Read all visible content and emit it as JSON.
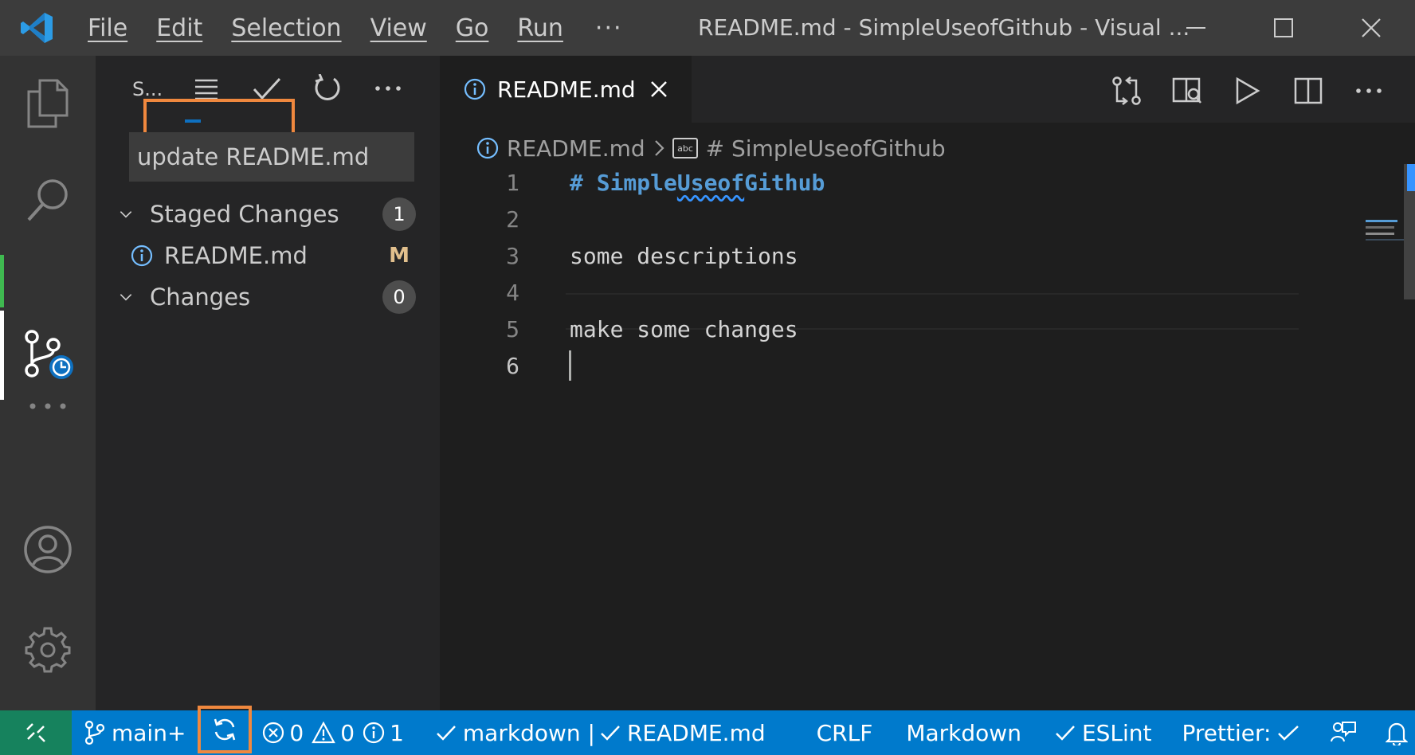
{
  "titlebar": {
    "menu": [
      "File",
      "Edit",
      "Selection",
      "View",
      "Go",
      "Run"
    ],
    "more": "···",
    "window_title": "README.md - SimpleUseofGithub - Visual ..."
  },
  "activitybar": {
    "items": [
      "explorer-icon",
      "search-icon",
      "source-control-icon",
      "more-icon",
      "account-icon",
      "settings-icon"
    ]
  },
  "sidebar": {
    "title": "S...",
    "commit_message": "update README.md",
    "staged": {
      "label": "Staged Changes",
      "count": "1"
    },
    "staged_files": [
      {
        "name": "README.md",
        "status": "M"
      }
    ],
    "changes": {
      "label": "Changes",
      "count": "0"
    }
  },
  "editor": {
    "tab_label": "README.md",
    "breadcrumb": {
      "file": "README.md",
      "symbol": "# SimpleUseofGithub"
    },
    "lines": [
      {
        "num": "1",
        "text": "# SimpleUseofGithub"
      },
      {
        "num": "2",
        "text": ""
      },
      {
        "num": "3",
        "text": "some descriptions"
      },
      {
        "num": "4",
        "text": ""
      },
      {
        "num": "5",
        "text": "make some changes"
      },
      {
        "num": "6",
        "text": ""
      }
    ],
    "heading_prefix": "# Simple",
    "heading_squiggle": "Useof",
    "heading_suffix": "Github"
  },
  "statusbar": {
    "branch": "main+",
    "errors": "0",
    "warnings": "0",
    "infos": "1",
    "lint": "markdown | ",
    "lint_file": "README.md",
    "eol": "CRLF",
    "language": "Markdown",
    "eslint": "ESLint",
    "prettier": "Prettier:"
  },
  "colors": {
    "accent": "#007acc",
    "highlight": "#f0883e",
    "remote": "#16825d"
  }
}
